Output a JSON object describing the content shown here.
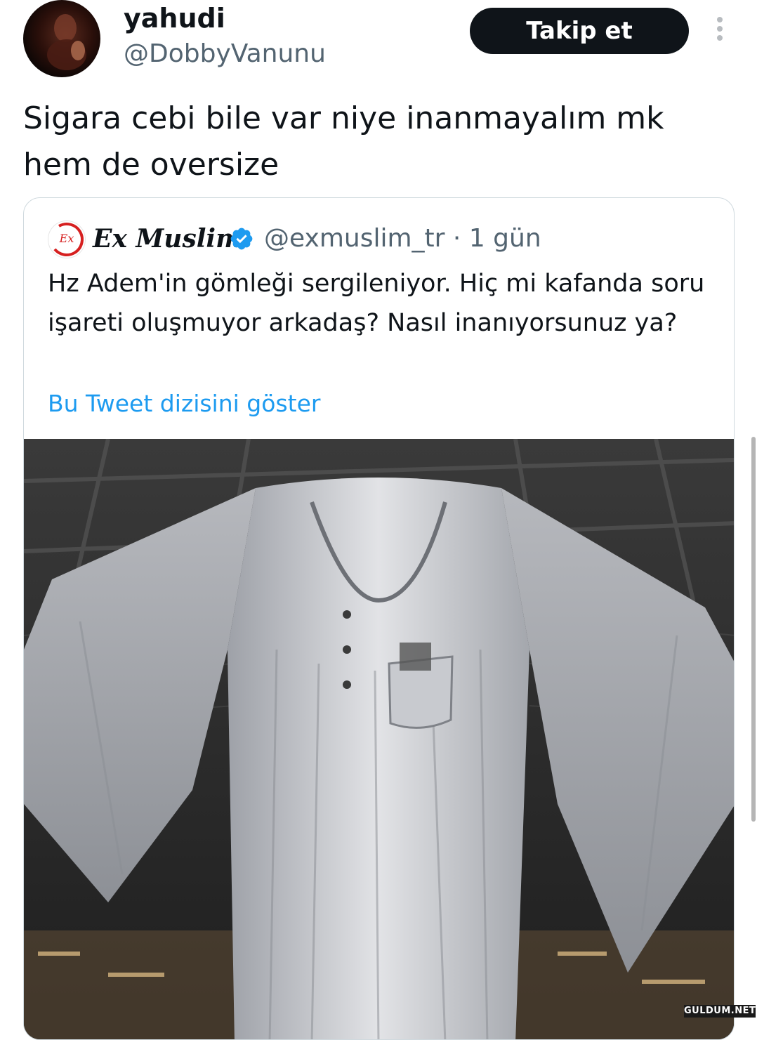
{
  "author": {
    "display_name": "yahudi",
    "handle": "@DobbyVanunu",
    "avatar_icon": "profile-photo"
  },
  "follow_button": {
    "label": "Takip et"
  },
  "more_icon": "more-vertical-icon",
  "tweet": {
    "text": "Sigara cebi bile var niye inanmayalım mk\nhem de oversize"
  },
  "quoted_tweet": {
    "display_name": "Ex Muslim",
    "avatar_text": "Ex",
    "verified": true,
    "handle": "@exmuslim_tr",
    "separator": "·",
    "time": "1 gün",
    "text": "Hz Adem'in gömleği sergileniyor. Hiç mi kafanda soru işareti oluşmuyor arkadaş? Nasıl inanıyorsunuz ya?",
    "thread_link": "Bu Tweet dizisini göster",
    "media_description_icon": "photo"
  },
  "watermark": "GULDUM.NET",
  "colors": {
    "text_primary": "#0f1419",
    "text_secondary": "#536471",
    "link": "#1d9bf0",
    "button_bg": "#0f1419",
    "border": "#cfd9de",
    "verified": "#1d9bf0"
  }
}
